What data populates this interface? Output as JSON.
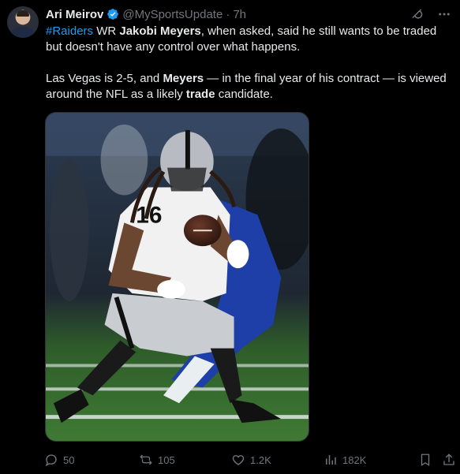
{
  "tweet": {
    "author_name": "Ari Meirov",
    "handle": "@MySportsUpdate",
    "separator": "·",
    "time": "7h",
    "paragraph1": {
      "hashtag": "#Raiders",
      "t1": " WR ",
      "b1": "Jakobi Meyers",
      "t2": ", when asked, said he still wants to be traded but doesn't have any control over what happens."
    },
    "paragraph2": {
      "t1": "Las Vegas is 2-5, and ",
      "b1": "Meyers",
      "t2": " — in the final year of his contract — is viewed around the NFL as a likely ",
      "b2": "trade",
      "t3": " candidate."
    },
    "media": {
      "jersey_number": "16"
    }
  },
  "actions": {
    "replies": "50",
    "reposts": "105",
    "likes": "1.2K",
    "views": "182K"
  },
  "colors": {
    "accent": "#1d9bf0",
    "muted": "#71767b",
    "text": "#e7e9ea",
    "background": "#000000"
  },
  "icons": [
    "verified-badge-icon",
    "grok-icon",
    "more-icon",
    "reply-icon",
    "repost-icon",
    "like-icon",
    "views-icon",
    "bookmark-icon",
    "share-icon"
  ]
}
